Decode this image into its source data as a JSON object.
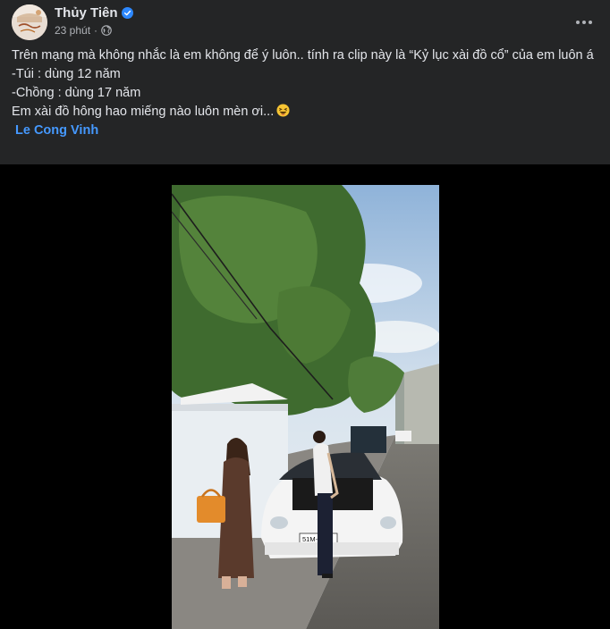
{
  "post": {
    "author": "Thủy Tiên",
    "timestamp": "23 phút",
    "separator": "·",
    "caption_lines": [
      "Trên mạng mà không nhắc là em không để ý luôn.. tính ra clip này là “Kỷ lục xài đồ cổ” của em luôn á",
      "-Túi : dùng 12 năm",
      "-Chồng : dùng 17 năm",
      "Em xài đồ hông hao miếng nào luôn mèn ơi..."
    ],
    "tagged_user": "Le Cong Vinh",
    "emoji_icon": "grinning-squinting-face-emoji",
    "audience_icon": "globe-icon",
    "more_icon": "ellipsis-icon"
  },
  "video": {
    "license_plate": "51M-549",
    "scene": "street-clip-porsche"
  },
  "colors": {
    "background": "#242526",
    "text": "#e4e6eb",
    "secondary_text": "#b0b3b8",
    "link": "#4599ff",
    "verified": "#2d88ff",
    "video_bg": "#000000"
  }
}
